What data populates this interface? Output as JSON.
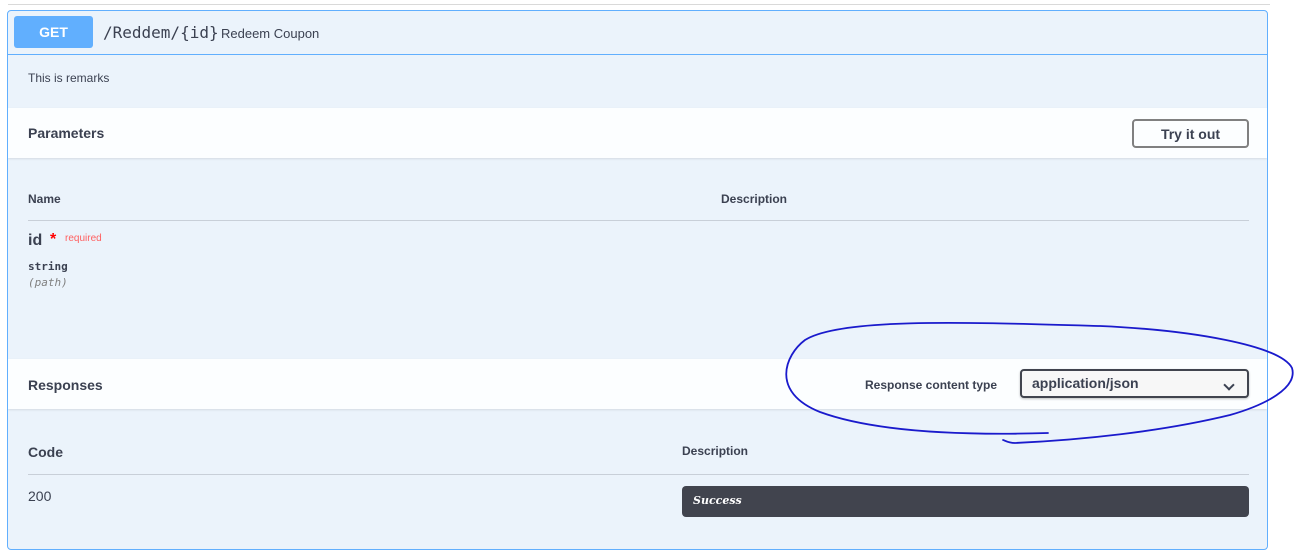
{
  "endpoint": {
    "method": "GET",
    "path": "/Reddem/{id}",
    "summary": "Redeem Coupon",
    "remarks": "This is remarks"
  },
  "parameters": {
    "title": "Parameters",
    "try_button": "Try it out",
    "columns": {
      "name": "Name",
      "description": "Description"
    },
    "items": [
      {
        "name": "id",
        "required_mark": "*",
        "required_label": "required",
        "type": "string",
        "in": "(path)"
      }
    ]
  },
  "responses": {
    "title": "Responses",
    "content_type_label": "Response content type",
    "content_type_value": "application/json",
    "columns": {
      "code": "Code",
      "description": "Description"
    },
    "items": [
      {
        "code": "200",
        "description": "Success"
      }
    ]
  },
  "colors": {
    "get_accent": "#61affe",
    "block_bg": "#ebf3fb",
    "annotation_ink": "#1a1acc"
  }
}
